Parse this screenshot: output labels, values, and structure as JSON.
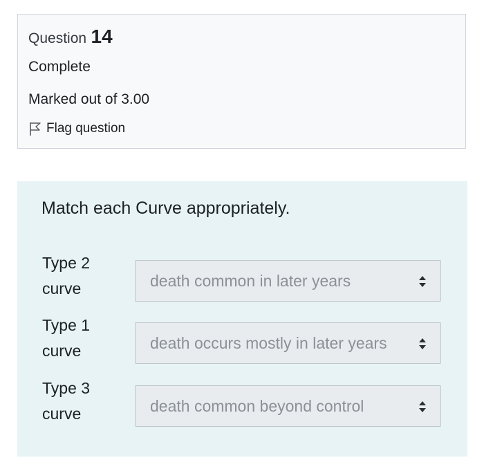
{
  "info": {
    "question_label": "Question",
    "question_number": "14",
    "state": "Complete",
    "grade": "Marked out of 3.00",
    "flag_label": "Flag question",
    "flag_icon": "flag-outline-icon"
  },
  "question": {
    "text": "Match each Curve appropriately.",
    "rows": [
      {
        "label": "Type 2 curve",
        "selected": "death common in later years"
      },
      {
        "label": "Type 1 curve",
        "selected": "death occurs mostly in later years"
      },
      {
        "label": "Type 3 curve",
        "selected": "death common beyond control"
      }
    ],
    "select_icon": "up-down-arrows-icon"
  },
  "colors": {
    "info_background": "#f8f9fa",
    "content_background": "#e7f3f5",
    "select_background": "#e9ecef",
    "select_text": "#8a9197"
  }
}
